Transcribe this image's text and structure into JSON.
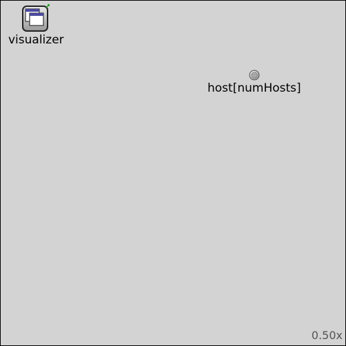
{
  "canvas": {
    "background_color": "#d3d3d3",
    "border_color": "#000000"
  },
  "modules": {
    "visualizer": {
      "label": "visualizer",
      "icon": "visualizer-window-icon"
    },
    "host": {
      "label": "host[numHosts]",
      "icon": "host-node-icon"
    }
  },
  "status": {
    "zoom": "0.50x"
  }
}
